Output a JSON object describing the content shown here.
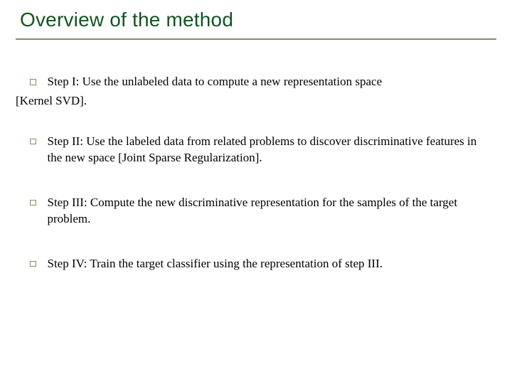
{
  "title": "Overview of the method",
  "step1": {
    "line1": "Step I: Use the unlabeled data to compute a new representation space",
    "line2": "[Kernel SVD]."
  },
  "step2": "Step II: Use the labeled data from related problems to discover discriminative features in the new space [Joint Sparse Regularization].",
  "step3": "Step III: Compute the new discriminative representation for the samples of the target problem.",
  "step4": "Step IV: Train the target classifier using the representation of step III."
}
